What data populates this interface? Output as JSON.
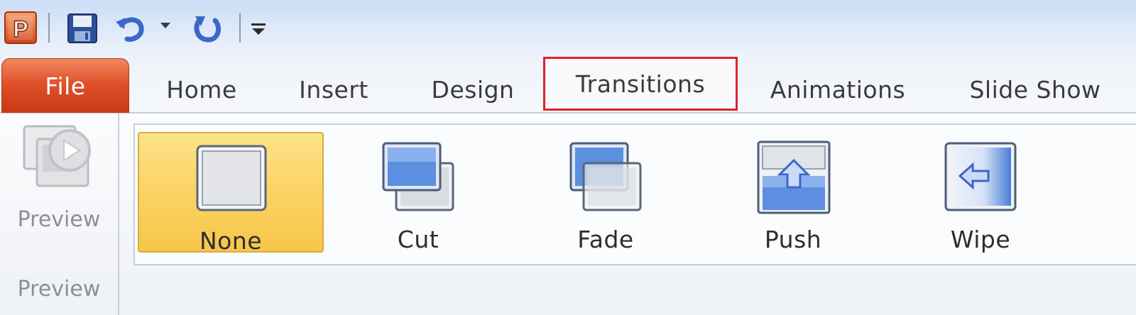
{
  "quick_access": {
    "app_icon_letter": "P",
    "icons": [
      "powerpoint-logo-icon",
      "save-icon",
      "undo-icon",
      "undo-dropdown-icon",
      "redo-icon",
      "customize-toolbar-icon"
    ]
  },
  "tabs": [
    {
      "label": "File"
    },
    {
      "label": "Home"
    },
    {
      "label": "Insert"
    },
    {
      "label": "Design"
    },
    {
      "label": "Transitions"
    },
    {
      "label": "Animations"
    },
    {
      "label": "Slide Show"
    }
  ],
  "ribbon": {
    "preview_group": {
      "button_label": "Preview",
      "group_label": "Preview"
    },
    "transitions": [
      {
        "label": "None",
        "selected": true
      },
      {
        "label": "Cut"
      },
      {
        "label": "Fade"
      },
      {
        "label": "Push"
      },
      {
        "label": "Wipe"
      }
    ]
  },
  "colors": {
    "file_tab": "#e0512a",
    "highlight_box": "#d9232f",
    "selected_item": "#fbd466"
  }
}
